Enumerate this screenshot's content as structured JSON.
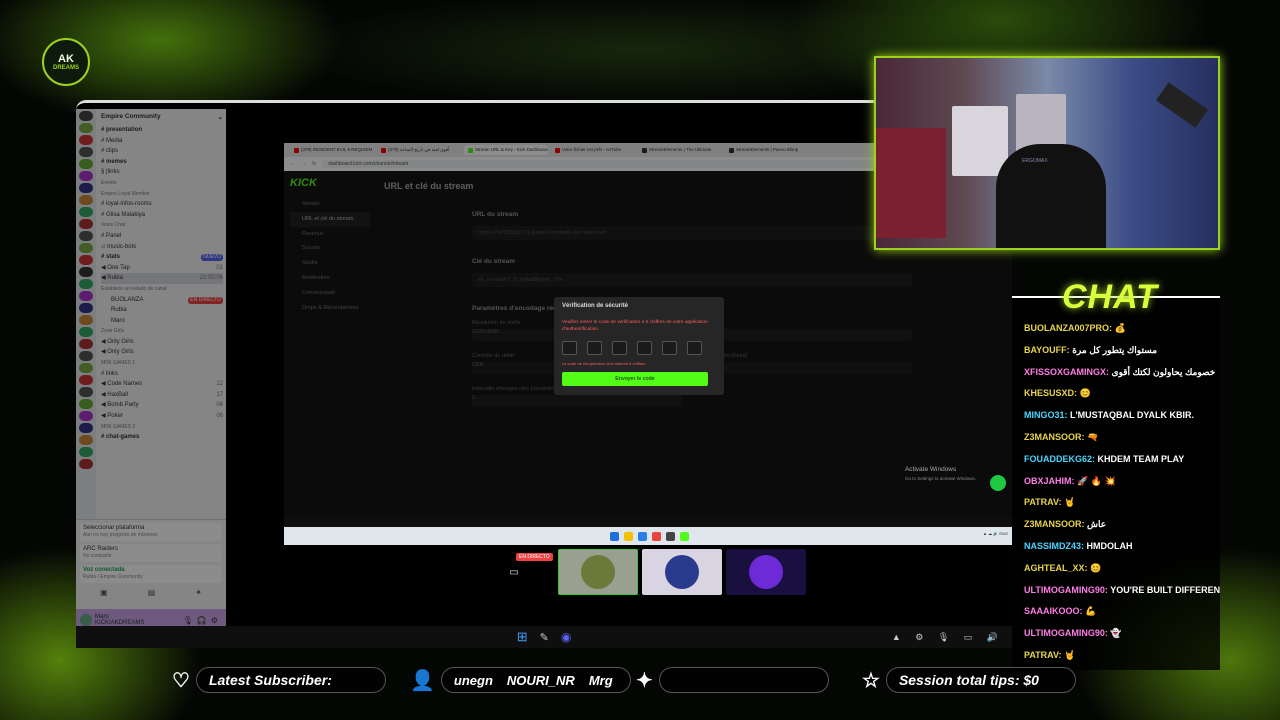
{
  "overlay": {
    "logo_text": "AK",
    "logo_sub": "DREAMS",
    "chat_title": "CHAT",
    "latest_subscriber_label": "Latest Subscriber:",
    "ticker_items": [
      "unegn",
      "NOURI_NR",
      "Mrg"
    ],
    "session_tips_label": "Session total tips: $0"
  },
  "discord": {
    "server_name": "Empire Community",
    "channels": [
      {
        "name": "# presentation",
        "type": "text",
        "bold": true
      },
      {
        "name": "# Media",
        "type": "text"
      },
      {
        "name": "# clips",
        "type": "text"
      },
      {
        "name": "# memes",
        "type": "text",
        "bold": true
      },
      {
        "name": "§ |links",
        "type": "text"
      },
      {
        "name": "Events",
        "type": "cat"
      },
      {
        "name": "Empire Loyal Member",
        "type": "cat"
      },
      {
        "name": "# loyal-infos-rooms",
        "type": "text"
      },
      {
        "name": "# Glisa Malakiya",
        "type": "text"
      },
      {
        "name": "Voice Chat",
        "type": "cat"
      },
      {
        "name": "# Panel",
        "type": "text"
      },
      {
        "name": "♫ music-bots",
        "type": "text"
      },
      {
        "name": "# stats",
        "type": "text",
        "bold": true,
        "badge": "NUEVO"
      },
      {
        "name": "◀ One Tap",
        "type": "voice",
        "count": "01"
      },
      {
        "name": "◀ Rubia",
        "type": "voice",
        "active": true,
        "count": "23:00:06"
      },
      {
        "name": "Establece un estado de canal",
        "type": "cat"
      },
      {
        "name": "BUOLANZA",
        "type": "user",
        "badge_live": "EN DIRECTO"
      },
      {
        "name": "Rubia",
        "type": "user"
      },
      {
        "name": "Maro",
        "type": "user"
      },
      {
        "name": "Zone Girls",
        "type": "cat"
      },
      {
        "name": "◀ Only Girls",
        "type": "voice"
      },
      {
        "name": "◀ Only Girls",
        "type": "voice"
      },
      {
        "name": "MINI GAMES 1",
        "type": "cat"
      },
      {
        "name": "# links",
        "type": "text"
      },
      {
        "name": "◀ Code Names",
        "type": "voice",
        "count": "12"
      },
      {
        "name": "◀ HaxBall",
        "type": "voice",
        "count": "17"
      },
      {
        "name": "◀ Bomb Party",
        "type": "voice",
        "count": "06"
      },
      {
        "name": "◀ Poker",
        "type": "voice",
        "count": "06"
      },
      {
        "name": "MINI GAMES 2",
        "type": "cat"
      },
      {
        "name": "# chat-games",
        "type": "text",
        "bold": true
      }
    ],
    "platform_card": {
      "title": "Seleccionar plataforma",
      "sub": "Aún no hay progreso de misiones"
    },
    "game_card": {
      "title": "ARC Raiders",
      "sub": "No compartir"
    },
    "voice_card": {
      "title": "Voz conectada",
      "sub": "Rubia / Empire Community"
    },
    "user": {
      "name": "Maro",
      "status": "KICK/AKDREAMS"
    }
  },
  "browser": {
    "tabs": [
      {
        "label": "(378) RESIDENT EVIL 9 REQUIEM",
        "color": "#ff0000"
      },
      {
        "label": "(378) أقوى لعبة في تاريخ الساحة",
        "color": "#ff0000"
      },
      {
        "label": "Stream URL & Key - Kick Dashboard",
        "color": "#53fc18",
        "active": true
      },
      {
        "label": "Votre fichier est prêt - noTube",
        "color": "#ff0000"
      },
      {
        "label": "StreamElements | The Ultimate",
        "color": "#333333"
      },
      {
        "label": "StreamElements | Paeso Blimp",
        "color": "#333333"
      }
    ],
    "url": "dashboard.kick.com/channel/stream"
  },
  "kick": {
    "logo": "KICK",
    "nav": [
      "Stream",
      "URL et clé du stream",
      "Revenus",
      "Succès",
      "Studio",
      "Modération",
      "Communauté",
      "Drops & Récompenses"
    ],
    "page_title": "URL et clé du stream",
    "stream_url_label": "URL du stream",
    "stream_url_value": "rtmps://fa723fc1b171.global-contribute.live-video.net",
    "stream_key_label": "Clé du stream",
    "stream_key_value": "sk_us-west-2_0_yolkaBlhgvlh_7ch",
    "reset_label": "Réinitialiser",
    "encoder_label": "Paramètres d'encodage recommandés",
    "resolution_label": "Résolution de sortie",
    "resolution_value": "1920x1080",
    "images_label": "Images",
    "bitrate_label": "Contrôle du débit",
    "bitrate_value": "CBR",
    "bitrate_video_label": "Débit vidéo (Kbps)",
    "bitrate_video_value": "6000",
    "keyframe_label": "Intervalle d'images clés (secondes)",
    "keyframe_value": "2"
  },
  "modal": {
    "title": "Vérification de sécurité",
    "text": "Veuillez entrer le code de vérification à 6 chiffres de votre application d'authentification.",
    "error": "Le code de récupération doit contenir 6 chiffres",
    "button": "Envoyer le code"
  },
  "windows": {
    "activate_title": "Activate Windows",
    "activate_sub": "Go to Settings to activate Windows.",
    "live_tag": "EN DIRECTO"
  },
  "webcam": {
    "chair_brand": "ERGOMAX"
  },
  "chat": [
    {
      "user": "BUOLANZA007PRO:",
      "text": "💰",
      "c": "1"
    },
    {
      "user": "BAYOUFF:",
      "text": "مستواك يتطور كل مرة",
      "c": "1"
    },
    {
      "user": "XFISSOXGAMINGX:",
      "text": "خصومك يحاولون لكتك أقوى",
      "c": "3"
    },
    {
      "user": "KHESUSXD:",
      "text": "😊",
      "c": "1"
    },
    {
      "user": "MINGO31:",
      "text": "L'MUSTAQBAL DYALK KBIR.",
      "c": "2"
    },
    {
      "user": "Z3MANSOOR:",
      "text": "🔫",
      "c": "1"
    },
    {
      "user": "FOUADDEKG62:",
      "text": "KHDEM TEAM PLAY",
      "c": "2"
    },
    {
      "user": "OBXJAHIM:",
      "text": "🚀 🔥 💥",
      "c": "3"
    },
    {
      "user": "PATRAV:",
      "text": "🤘",
      "c": "1"
    },
    {
      "user": "Z3MANSOOR:",
      "text": "عاش",
      "c": "1"
    },
    {
      "user": "NASSIMDZ43:",
      "text": "HMDOLAH",
      "c": "2"
    },
    {
      "user": "AGHTEAL_XX:",
      "text": "😊",
      "c": "1"
    },
    {
      "user": "ULTIMOGAMING90:",
      "text": "YOU'RE BUILT DIFFERENT",
      "c": "3"
    },
    {
      "user": "SAAAIKOOO:",
      "text": "💪",
      "c": "3"
    },
    {
      "user": "ULTIMOGAMING90:",
      "text": "👻",
      "c": "3"
    },
    {
      "user": "PATRAV:",
      "text": "🤘",
      "c": "1"
    }
  ],
  "colors": {
    "accent": "#9cd21e",
    "kick_green": "#53fc18",
    "chat_title": "#d9ff3a"
  }
}
